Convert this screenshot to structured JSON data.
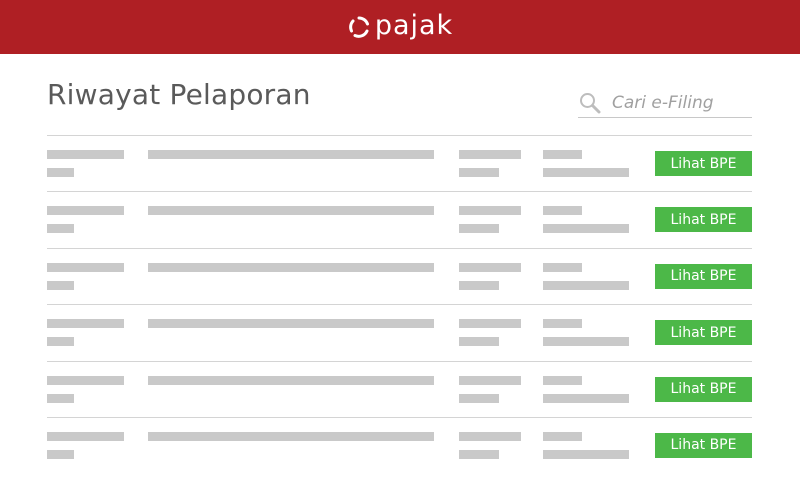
{
  "header": {
    "brand": "pajak",
    "background_color": "#af1f24"
  },
  "page": {
    "title": "Riwayat Pelaporan"
  },
  "search": {
    "placeholder": "Cari e-Filing",
    "value": "",
    "icon": "magnifier-icon"
  },
  "table": {
    "rows": [
      {
        "action_label": "Lihat BPE"
      },
      {
        "action_label": "Lihat BPE"
      },
      {
        "action_label": "Lihat BPE"
      },
      {
        "action_label": "Lihat BPE"
      },
      {
        "action_label": "Lihat BPE"
      },
      {
        "action_label": "Lihat BPE"
      }
    ],
    "placeholder_color": "#c9c9c9",
    "button_color": "#4cb848"
  }
}
